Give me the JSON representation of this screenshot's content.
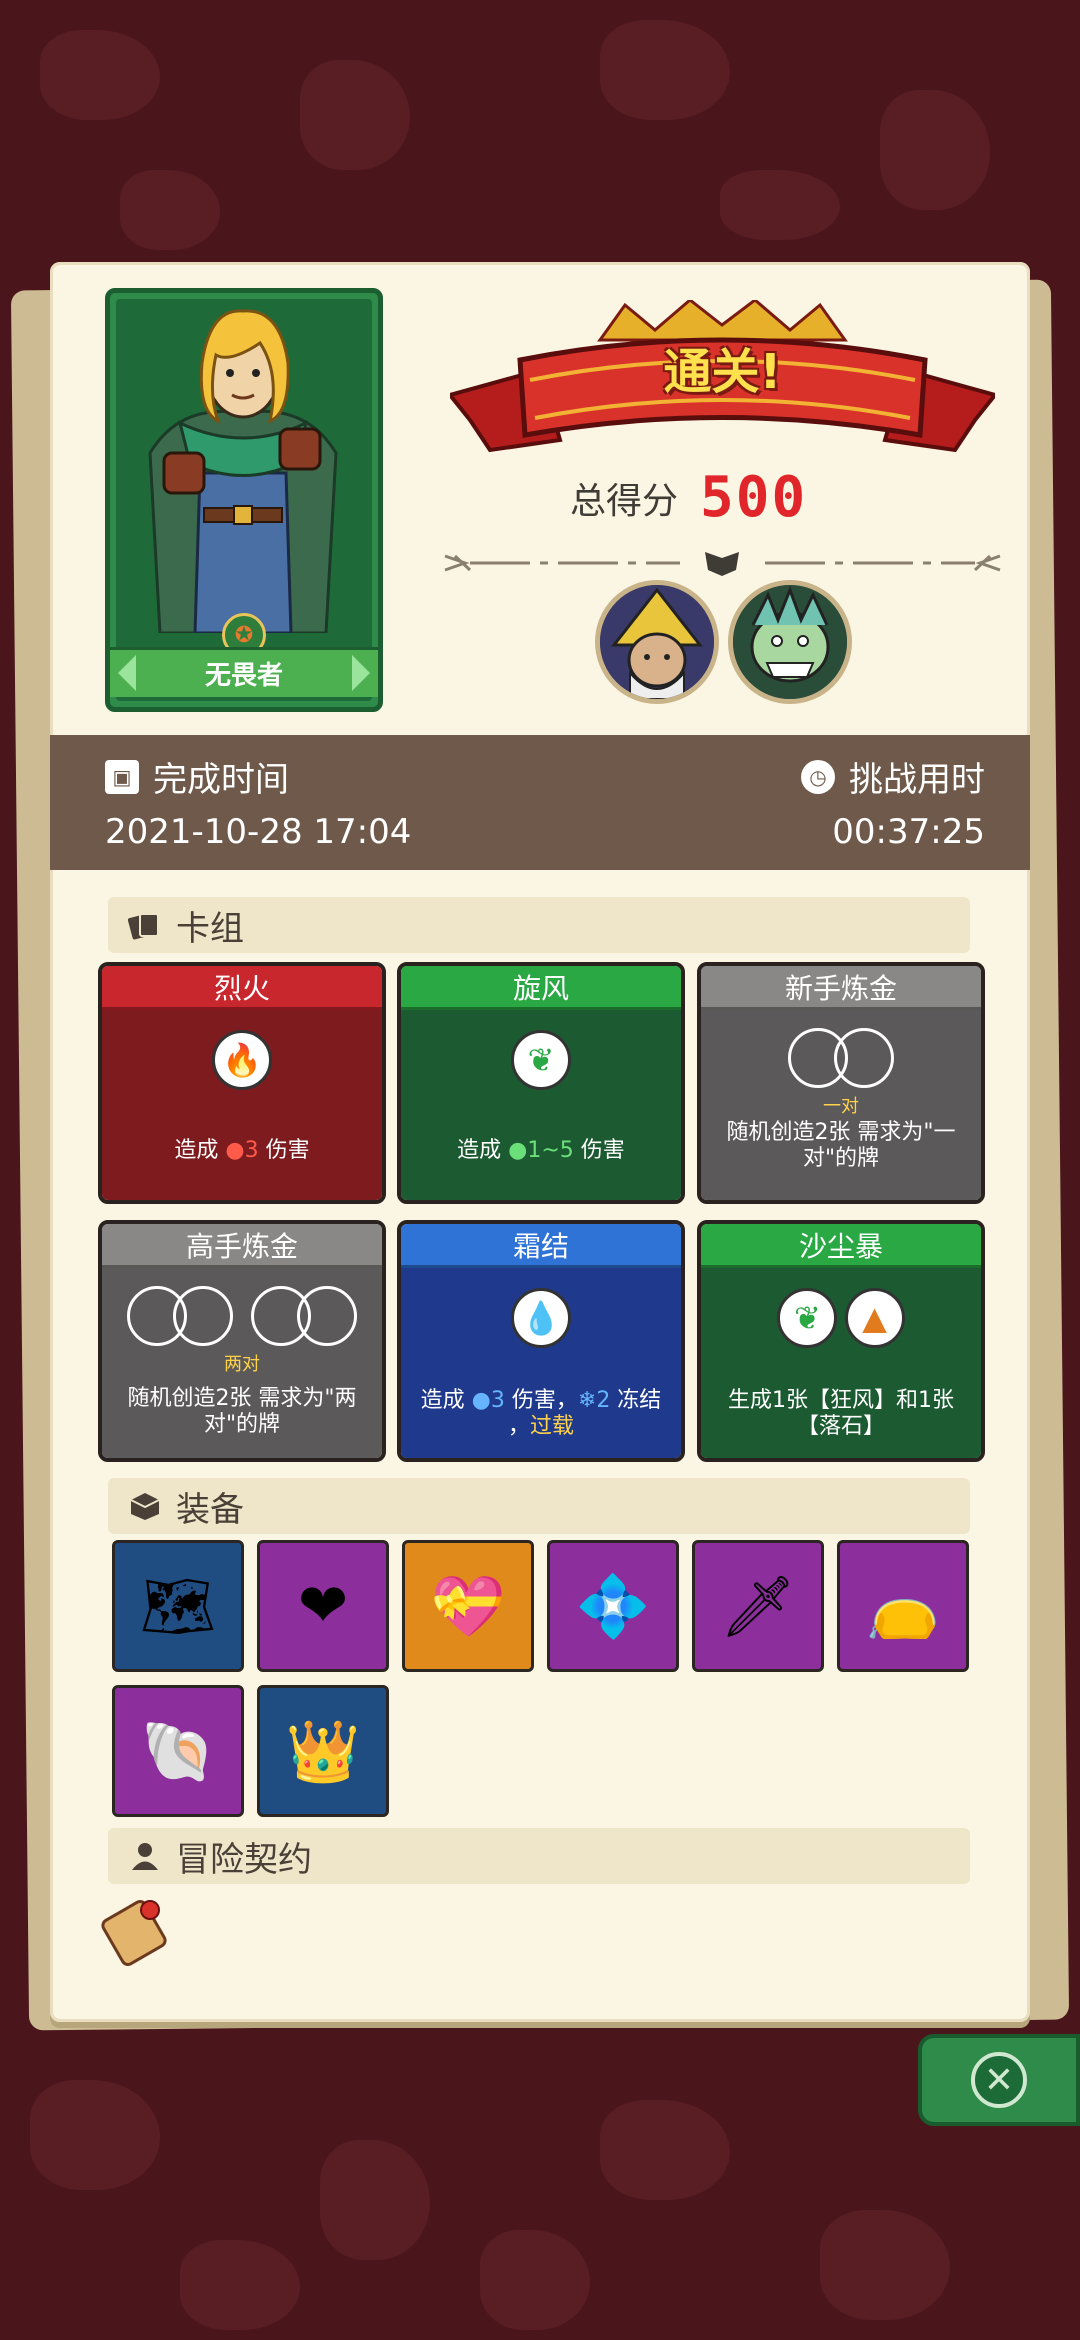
{
  "hero": {
    "name": "无畏者"
  },
  "result": {
    "banner": "通关!",
    "score_label": "总得分",
    "score_value": "500"
  },
  "time": {
    "finish_label": "完成时间",
    "finish_value": "2021-10-28 17:04",
    "duration_label": "挑战用时",
    "duration_value": "00:37:25"
  },
  "sections": {
    "deck": "卡组",
    "equipment": "装备",
    "contract": "冒险契约"
  },
  "deck": [
    {
      "title": "烈火",
      "color": "red",
      "icon": "fire-icon",
      "desc_pre": "造成 ",
      "desc_hl": "3",
      "desc_post": " 伤害"
    },
    {
      "title": "旋风",
      "color": "green",
      "icon": "wind-icon",
      "desc_pre": "造成 ",
      "desc_hl": "1~5",
      "desc_post": " 伤害"
    },
    {
      "title": "新手炼金",
      "color": "gray",
      "icon": "pair-circles-icon",
      "pair_label": "一对",
      "desc": "随机创造2张 需求为\"一对\"的牌"
    },
    {
      "title": "高手炼金",
      "color": "gray",
      "icon": "two-pair-circles-icon",
      "pair_label": "两对",
      "desc": "随机创造2张 需求为\"两对\"的牌"
    },
    {
      "title": "霜结",
      "color": "blue",
      "icon": "water-drop-icon",
      "desc_a": "造成 ",
      "desc_b": "3",
      "desc_c": " 伤害，",
      "desc_d": "2",
      "desc_e": " 冻结",
      "desc_f": "，",
      "desc_g": "过载"
    },
    {
      "title": "沙尘暴",
      "color": "green",
      "icon": "wind-rock-icon",
      "desc": "生成1张【狂风】和1张【落石】"
    }
  ],
  "equipment": [
    {
      "icon": "treasure-map-icon",
      "bg": "blue"
    },
    {
      "icon": "heart-shield-icon",
      "bg": "purple"
    },
    {
      "icon": "heart-box-icon",
      "bg": "orange"
    },
    {
      "icon": "crystal-mask-icon",
      "bg": "purple"
    },
    {
      "icon": "red-dagger-icon",
      "bg": "purple"
    },
    {
      "icon": "leather-pouch-icon",
      "bg": "purple"
    },
    {
      "icon": "spotted-shell-icon",
      "bg": "purple"
    },
    {
      "icon": "golden-crown-icon",
      "bg": "blue"
    }
  ],
  "contract": {
    "icon": "scroll-icon"
  },
  "colors": {
    "background": "#4a151b",
    "paper": "#fbf6e3",
    "score": "#e0262a",
    "band": "#6e594a"
  }
}
